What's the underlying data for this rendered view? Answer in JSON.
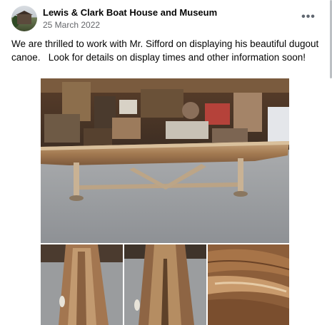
{
  "post": {
    "page_name": "Lewis & Clark Boat House and Museum",
    "date": "25 March 2022",
    "text": "We are thrilled to work with Mr. Sifford on displaying his beautiful dugout canoe.   Look for details on display times and other information soon!",
    "more_icon": "more-horizontal-icon"
  },
  "colors": {
    "name": "#050505",
    "meta": "#65676b",
    "floor": "#9ea1a6",
    "wood": "#b28a5e"
  },
  "photos": [
    {
      "name": "dugout-canoe-on-stand-photo"
    },
    {
      "name": "canoe-interior-photo-1"
    },
    {
      "name": "canoe-interior-photo-2"
    },
    {
      "name": "canoe-wood-closeup-photo"
    }
  ]
}
